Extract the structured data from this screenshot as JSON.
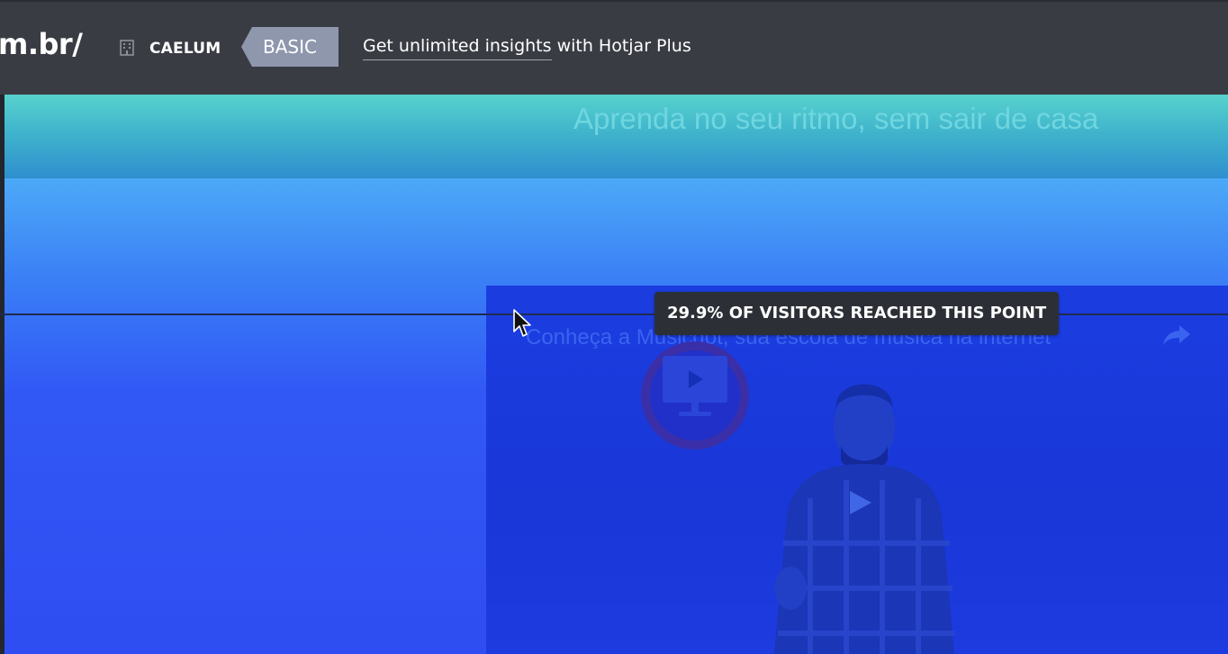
{
  "header": {
    "url_fragment": "m.br/",
    "org_name": "CAELUM",
    "plan_badge": "BASIC",
    "upsell_link": "Get unlimited insights",
    "upsell_suffix": " with Hotjar Plus"
  },
  "page": {
    "hero_text": "Aprenda no seu ritmo, sem sair de casa",
    "video_title": "Conheça a Musicdot, sua escola de música na internet"
  },
  "scroll_marker": {
    "percent_label": "29.9% OF VISITORS REACHED THIS POINT",
    "percent_value": 29.9
  },
  "colors": {
    "topbar": "#3a3c44",
    "teal_band": "#40b4cc",
    "blue_band": "#2f4df2",
    "tooltip_bg": "#2c3036",
    "plan_badge_bg": "#8f97ad"
  },
  "icons": {
    "org": "building-icon",
    "share": "share-arrow-icon",
    "cursor": "mouse-pointer-icon",
    "video_play": "play-icon"
  }
}
